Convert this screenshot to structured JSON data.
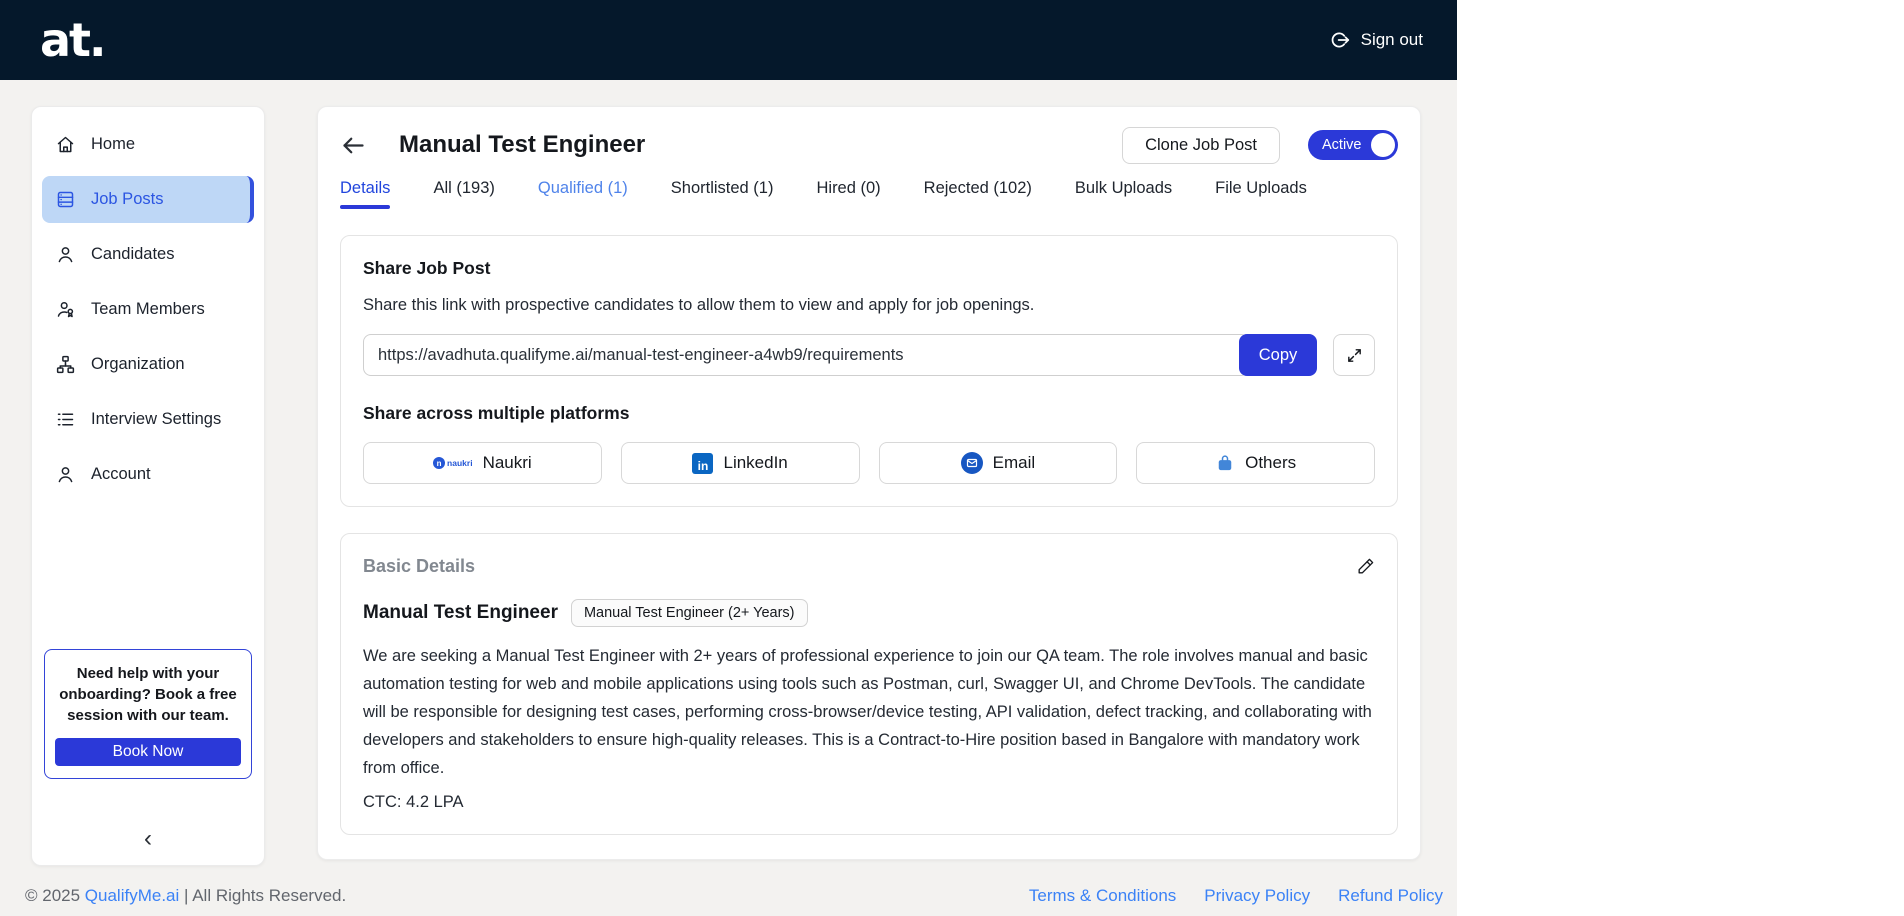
{
  "brand": {
    "logo": "at.",
    "signout_label": "Sign out"
  },
  "sidebar": {
    "items": [
      {
        "label": "Home",
        "icon": "home-icon",
        "active": false
      },
      {
        "label": "Job Posts",
        "icon": "job-posts-icon",
        "active": true
      },
      {
        "label": "Candidates",
        "icon": "person-icon",
        "active": false
      },
      {
        "label": "Team Members",
        "icon": "team-icon",
        "active": false
      },
      {
        "label": "Organization",
        "icon": "org-chart-icon",
        "active": false
      },
      {
        "label": "Interview Settings",
        "icon": "list-icon",
        "active": false
      },
      {
        "label": "Account",
        "icon": "person-icon",
        "active": false
      }
    ],
    "help": {
      "text": "Need help with your onboarding? Book a free session with our team.",
      "cta": "Book Now"
    },
    "collapse": "‹"
  },
  "page": {
    "title": "Manual Test Engineer",
    "clone_button": "Clone Job Post",
    "status_toggle": "Active",
    "tabs": [
      {
        "label": "Details"
      },
      {
        "label": "All (193)"
      },
      {
        "label": "Qualified (1)"
      },
      {
        "label": "Shortlisted (1)"
      },
      {
        "label": "Hired (0)"
      },
      {
        "label": "Rejected (102)"
      },
      {
        "label": "Bulk Uploads"
      },
      {
        "label": "File Uploads"
      }
    ]
  },
  "share": {
    "title": "Share Job Post",
    "description": "Share this link with prospective candidates to allow them to view and apply for job openings.",
    "link": "https://avadhuta.qualifyme.ai/manual-test-engineer-a4wb9/requirements",
    "copy_button": "Copy",
    "platforms_title": "Share across multiple platforms",
    "platforms": [
      {
        "label": "Naukri",
        "icon": "naukri-icon"
      },
      {
        "label": "LinkedIn",
        "icon": "linkedin-icon"
      },
      {
        "label": "Email",
        "icon": "email-icon"
      },
      {
        "label": "Others",
        "icon": "bag-icon"
      }
    ]
  },
  "basic": {
    "title": "Basic Details",
    "job_title": "Manual Test Engineer",
    "badge": "Manual Test Engineer (2+ Years)",
    "description": "We are seeking a Manual Test Engineer with 2+ years of professional experience to join our QA team. The role involves manual and basic automation testing for web and mobile applications using tools such as Postman, curl, Swagger UI, and Chrome DevTools. The candidate will be responsible for designing test cases, performing cross-browser/device testing, API validation, defect tracking, and collaborating with developers and stakeholders to ensure high-quality releases. This is a Contract-to-Hire position based in Bangalore with mandatory work from office.",
    "ctc": "CTC: 4.2 LPA"
  },
  "footer": {
    "copyright_prefix": "© 2025 ",
    "brand_link": "QualifyMe.ai",
    "copyright_suffix": " | All Rights Reserved.",
    "links": [
      "Terms & Conditions",
      "Privacy Policy",
      "Refund Policy"
    ]
  },
  "colors": {
    "header_bg": "#05182b",
    "primary_blue": "#2b39d8",
    "sidebar_active_bg": "#bed7f6",
    "sidebar_active_text": "#2b55e2",
    "link_blue": "#3b82f6",
    "linkedin_blue": "#0a66c2"
  }
}
